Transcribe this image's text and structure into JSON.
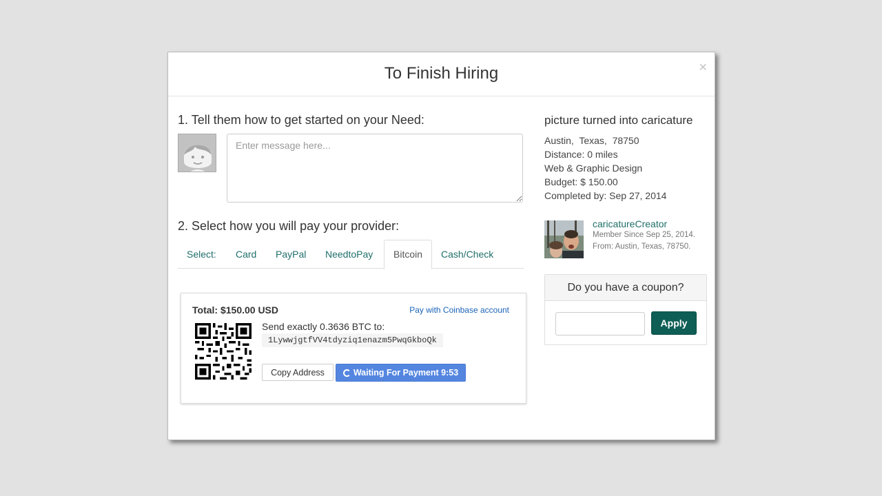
{
  "modal": {
    "title": "To Finish Hiring",
    "close_symbol": "×"
  },
  "step1": {
    "label": "1. Tell them how to get started on your Need:",
    "message_placeholder": "Enter message here..."
  },
  "step2": {
    "label": "2. Select how you will pay your provider:",
    "tabs": [
      {
        "label": "Select:",
        "active": false
      },
      {
        "label": "Card",
        "active": false
      },
      {
        "label": "PayPal",
        "active": false
      },
      {
        "label": "NeedtoPay",
        "active": false
      },
      {
        "label": "Bitcoin",
        "active": true
      },
      {
        "label": "Cash/Check",
        "active": false
      }
    ]
  },
  "bitcoin": {
    "total": "Total: $150.00 USD",
    "coinbase_link": "Pay with Coinbase account",
    "send_text": "Send exactly 0.3636 BTC to:",
    "address": "1LywwjgtfVV4tdyziq1enazm5PwqGkboQk",
    "copy_button": "Copy Address",
    "waiting_button": "Waiting For Payment 9:53"
  },
  "need": {
    "title": "picture turned into caricature",
    "location": "Austin,  Texas,  78750",
    "distance": "Distance: 0 miles",
    "category": "Web & Graphic Design",
    "budget": "Budget: $ 150.00",
    "completed_by": "Completed by: Sep 27, 2014"
  },
  "provider": {
    "name": "caricatureCreator",
    "member_since": "Member Since Sep 25, 2014.",
    "from": "From: Austin, Texas, 78750."
  },
  "coupon": {
    "heading": "Do you have a coupon?",
    "apply_button": "Apply",
    "input_value": ""
  },
  "colors": {
    "link_teal": "#1f6f6a",
    "apply_green": "#0e5e55",
    "waiting_blue": "#5486e0",
    "coinbase_blue": "#1a63b8"
  },
  "icons": {
    "close": "close-icon",
    "spinner": "spinner-icon",
    "avatar": "default-avatar-icon",
    "qr": "qr-code"
  }
}
